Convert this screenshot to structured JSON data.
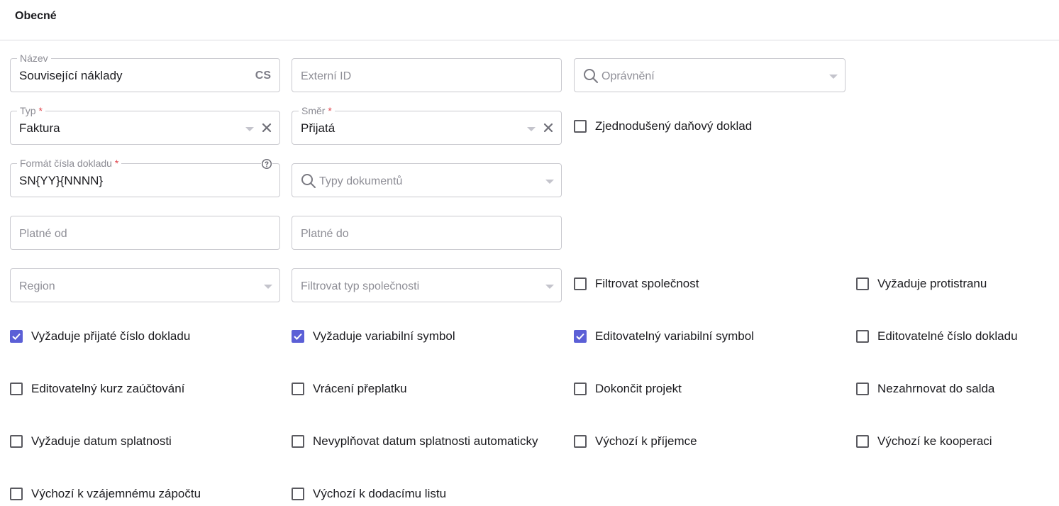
{
  "section": {
    "title": "Obecné"
  },
  "fields": {
    "nazev": {
      "label": "Název",
      "value": "Související náklady",
      "lang": "CS"
    },
    "externi_id": {
      "placeholder": "Externí ID"
    },
    "opravneni": {
      "placeholder": "Oprávnění",
      "icon": "search-icon"
    },
    "typ": {
      "label": "Typ",
      "required_mark": "*",
      "value": "Faktura"
    },
    "smer": {
      "label": "Směr",
      "required_mark": "*",
      "value": "Přijatá"
    },
    "format": {
      "label": "Formát čísla dokladu",
      "required_mark": "*",
      "value": "SN{YY}{NNNN}",
      "help_icon": "help-circle-icon"
    },
    "typy_dokumentu": {
      "placeholder": "Typy dokumentů",
      "icon": "search-icon"
    },
    "platne_od": {
      "placeholder": "Platné od"
    },
    "platne_do": {
      "placeholder": "Platné do"
    },
    "region": {
      "placeholder": "Region"
    },
    "filtrovat_typ": {
      "placeholder": "Filtrovat typ společnosti"
    }
  },
  "checkboxes": {
    "zjednoduseny": {
      "label": "Zjednodušený daňový doklad",
      "checked": false
    },
    "filtrovat_spolecnost": {
      "label": "Filtrovat společnost",
      "checked": false
    },
    "vyzaduje_protistranu": {
      "label": "Vyžaduje protistranu",
      "checked": false
    },
    "vyzaduje_prijate_cislo": {
      "label": "Vyžaduje přijaté číslo dokladu",
      "checked": true
    },
    "vyzaduje_variabilni": {
      "label": "Vyžaduje variabilní symbol",
      "checked": true
    },
    "editovatelny_variabilni": {
      "label": "Editovatelný variabilní symbol",
      "checked": true
    },
    "editovatelne_cislo": {
      "label": "Editovatelné číslo dokladu",
      "checked": false
    },
    "editovatelny_kurz": {
      "label": "Editovatelný kurz zaúčtování",
      "checked": false
    },
    "vraceni_preplatku": {
      "label": "Vrácení přeplatku",
      "checked": false
    },
    "dokoncit_projekt": {
      "label": "Dokončit projekt",
      "checked": false
    },
    "nezahrnovat_salda": {
      "label": "Nezahrnovat do salda",
      "checked": false
    },
    "vyzaduje_datum_splatnosti": {
      "label": "Vyžaduje datum splatnosti",
      "checked": false
    },
    "nevyplnovat_datum": {
      "label": "Nevyplňovat datum splatnosti automaticky",
      "checked": false
    },
    "vychozi_prijemce": {
      "label": "Výchozí k příjemce",
      "checked": false
    },
    "vychozi_kooperaci": {
      "label": "Výchozí ke kooperaci",
      "checked": false
    },
    "vychozi_zapoctu": {
      "label": "Výchozí k vzájemnému zápočtu",
      "checked": false
    },
    "vychozi_dodacimu": {
      "label": "Výchozí k dodacímu listu",
      "checked": false
    }
  },
  "colors": {
    "accent": "#5b5fd6",
    "required": "#e0454d",
    "border": "#c9c9cf"
  }
}
